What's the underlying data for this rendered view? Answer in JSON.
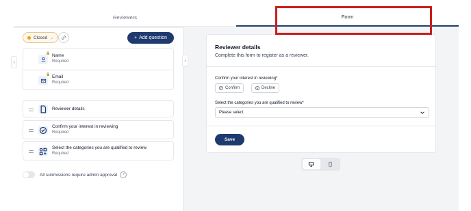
{
  "tabs": [
    {
      "label": "Reviewers",
      "active": false
    },
    {
      "label": "Form",
      "active": true
    }
  ],
  "toolbar": {
    "status_label": "Closed",
    "add_question_label": "Add question"
  },
  "fixed_fields": [
    {
      "name": "Name",
      "sub": "Required",
      "icon": "user-icon"
    },
    {
      "name": "Email",
      "sub": "Required",
      "icon": "mail-icon"
    }
  ],
  "questions": [
    {
      "name": "Reviewer details",
      "sub": "",
      "icon": "document-icon"
    },
    {
      "name": "Confirm your interest in reviewing",
      "sub": "Required",
      "icon": "check-circle-icon"
    },
    {
      "name": "Select the categories you are qualified to review",
      "sub": "Required",
      "icon": "categories-icon"
    }
  ],
  "approval": {
    "label": "All submissions require admin approval",
    "enabled": false
  },
  "form_preview": {
    "title": "Reviewer details",
    "subtitle": "Complete this form to register as a reviewer.",
    "q1_label": "Confirm your interest in reviewing*",
    "q1_options": [
      "Confirm",
      "Decline"
    ],
    "q2_label": "Select the categories you are qualified to review*",
    "q2_placeholder": "Please select",
    "save_label": "Save"
  },
  "device_toggle": {
    "active": "desktop"
  },
  "colors": {
    "primary": "#1e3a6e",
    "status_dot": "#f59e0b",
    "highlight": "#c81e1e"
  }
}
